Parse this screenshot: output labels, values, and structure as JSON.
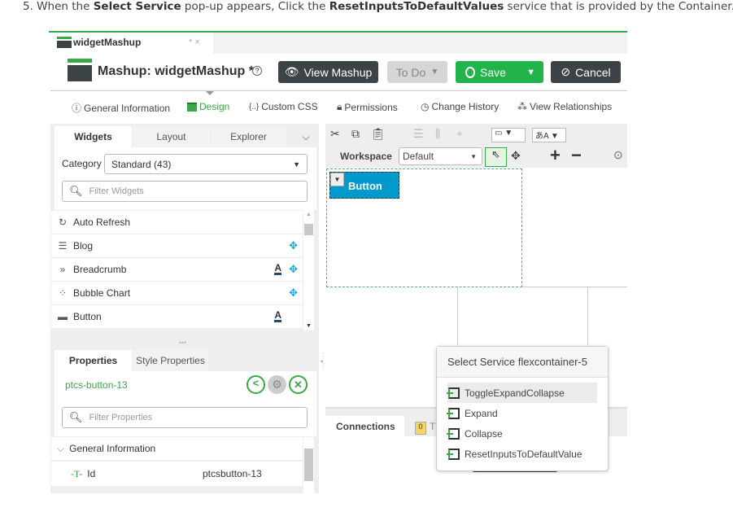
{
  "instruction": {
    "prefix": "5. When the ",
    "b1": "Select Service",
    "mid": " pop-up appears, Click the ",
    "b2": "ResetInputsToDefaultValues",
    "suffix": " service that is provided by the Container."
  },
  "tab": {
    "title": "widgetMashup",
    "modified": "* ×"
  },
  "header": {
    "title": "Mashup: widgetMashup *",
    "help": "?",
    "view": "View Mashup",
    "todo": "To Do",
    "save": "Save",
    "cancel": "Cancel"
  },
  "nav": [
    "General Information",
    "Design",
    "Custom CSS",
    "Permissions",
    "Change History",
    "View Relationships"
  ],
  "widgets": {
    "tabs": [
      "Widgets",
      "Layout",
      "Explorer"
    ],
    "category_label": "Category",
    "category_value": "Standard (43)",
    "filter_placeholder": "Filter Widgets",
    "items": [
      {
        "label": "Auto Refresh",
        "a": false,
        "move": false
      },
      {
        "label": "Blog",
        "a": false,
        "move": true
      },
      {
        "label": "Breadcrumb",
        "a": true,
        "move": true
      },
      {
        "label": "Bubble Chart",
        "a": false,
        "move": true
      },
      {
        "label": "Button",
        "a": true,
        "move": false
      }
    ]
  },
  "properties": {
    "tabs": [
      "Properties",
      "Style Properties"
    ],
    "widget_id": "ptcs-button-13",
    "filter_placeholder": "Filter Properties",
    "section": "General Information",
    "rows": [
      {
        "name": "Id",
        "value": "ptcsbutton-13"
      }
    ]
  },
  "toolbar": {
    "workspace_label": "Workspace",
    "workspace_value": "Default"
  },
  "canvas": {
    "button_label": "Button"
  },
  "bottom": {
    "connections": "Connections",
    "badge": "0",
    "tab2": "T"
  },
  "popup": {
    "title": "Select Service flexcontainer-5",
    "services": [
      "ToggleExpandCollapse",
      "Expand",
      "Collapse",
      "ResetInputsToDefaultValue"
    ]
  },
  "colors": {
    "green": "#3aa845",
    "dark": "#3b4346",
    "blue": "#0099cc"
  }
}
